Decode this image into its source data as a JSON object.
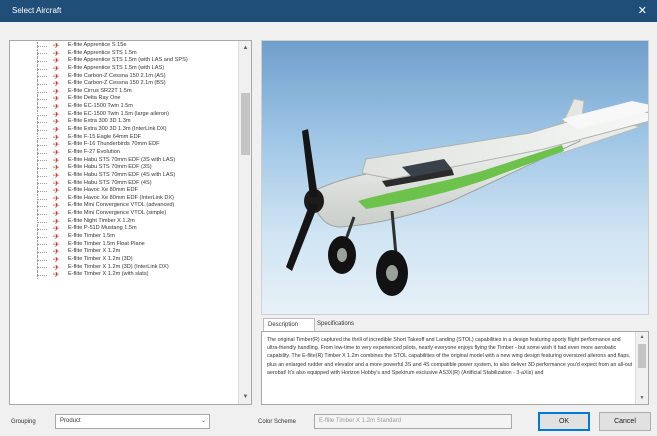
{
  "window": {
    "title": "Select Aircraft",
    "close_glyph": "✕"
  },
  "tree": {
    "items": [
      "E-flite Apprentice S 15e",
      "E-flite Apprentice STS 1.5m",
      "E-flite Apprentice STS 1.5m (with LAS and SPS)",
      "E-flite Apprentice STS 1.5m (with LAS)",
      "E-flite Carbon-Z Cessna 150 2.1m (AS)",
      "E-flite Carbon-Z Cessna 150 2.1m (BS)",
      "E-flite Cirrus SR22T 1.5m",
      "E-flite Delta Ray One",
      "E-flite EC-1500 Twin 1.5m",
      "E-flite EC-1500 Twin 1.5m (large aileron)",
      "E-flite Extra 300 3D 1.3m",
      "E-flite Extra 300 3D 1.3m (InterLink DX)",
      "E-flite F-15 Eagle 64mm EDF",
      "E-flite F-16 Thunderbirds 70mm EDF",
      "E-flite F-27 Evolution",
      "E-flite Habu STS 70mm EDF (3S with LAS)",
      "E-flite Habu STS 70mm EDF (3S)",
      "E-flite Habu STS 70mm EDF (4S with LAS)",
      "E-flite Habu STS 70mm EDF (4S)",
      "E-flite Havoc Xe 80mm EDF",
      "E-flite Havoc Xe 80mm EDF (InterLink DX)",
      "E-flite Mini Convergence VTOL (advanced)",
      "E-flite Mini Convergence VTOL (simple)",
      "E-flite Night Timber X 1.2m",
      "E-flite P-51D Mustang 1.5m",
      "E-flite Timber 1.5m",
      "E-flite Timber 1.5m Float Plane",
      "E-flite Timber X 1.2m",
      "E-flite Timber X 1.2m (3D)",
      "E-flite Timber X 1.2m (3D) (InterLink DX)",
      "E-flite Timber X 1.2m (with slats)"
    ],
    "scroll_up": "▲",
    "scroll_down": "▼"
  },
  "preview_icon": "airplane-render-image",
  "tabs": [
    "Description",
    "Specifications"
  ],
  "description": {
    "text": "The original Timber(R) captured the thrill of incredible Short Takeoff and Landing (STOL) capabilities in a design featuring sporty flight performance and ultra-friendly handling. From low-time to very experienced pilots, nearly everyone enjoys flying the Timber - but some wish it had even more aerobatic capability. The E-flite(R) Timber X 1.2m combines the STOL capabilities of the original model with a new wing design featuring oversized ailerons and flaps, plus an enlarged rudder and elevator and a more powerful 3S and 4S compatible power system, to also deliver 3D performance you'd expect from an all-out aerobat! It's also equipped with Horizon Hobby's and Spektrum exclusive AS3X(R) (Artificial Stabilization - 3-aXis) and",
    "scroll_up": "▲",
    "scroll_down": "▼"
  },
  "grouping": {
    "label": "Grouping",
    "value": "Product"
  },
  "color_scheme": {
    "label": "Color Scheme",
    "value": "E-flite Timber X 1.2m Standard"
  },
  "buttons": {
    "ok": "OK",
    "cancel": "Cancel"
  },
  "colors": {
    "titlebar": "#1f4e79",
    "airframe_white": "#eef0ee",
    "airframe_green": "#6cc24a",
    "tree_icon_red": "#c0392b",
    "default_button_border": "#0078d7"
  }
}
